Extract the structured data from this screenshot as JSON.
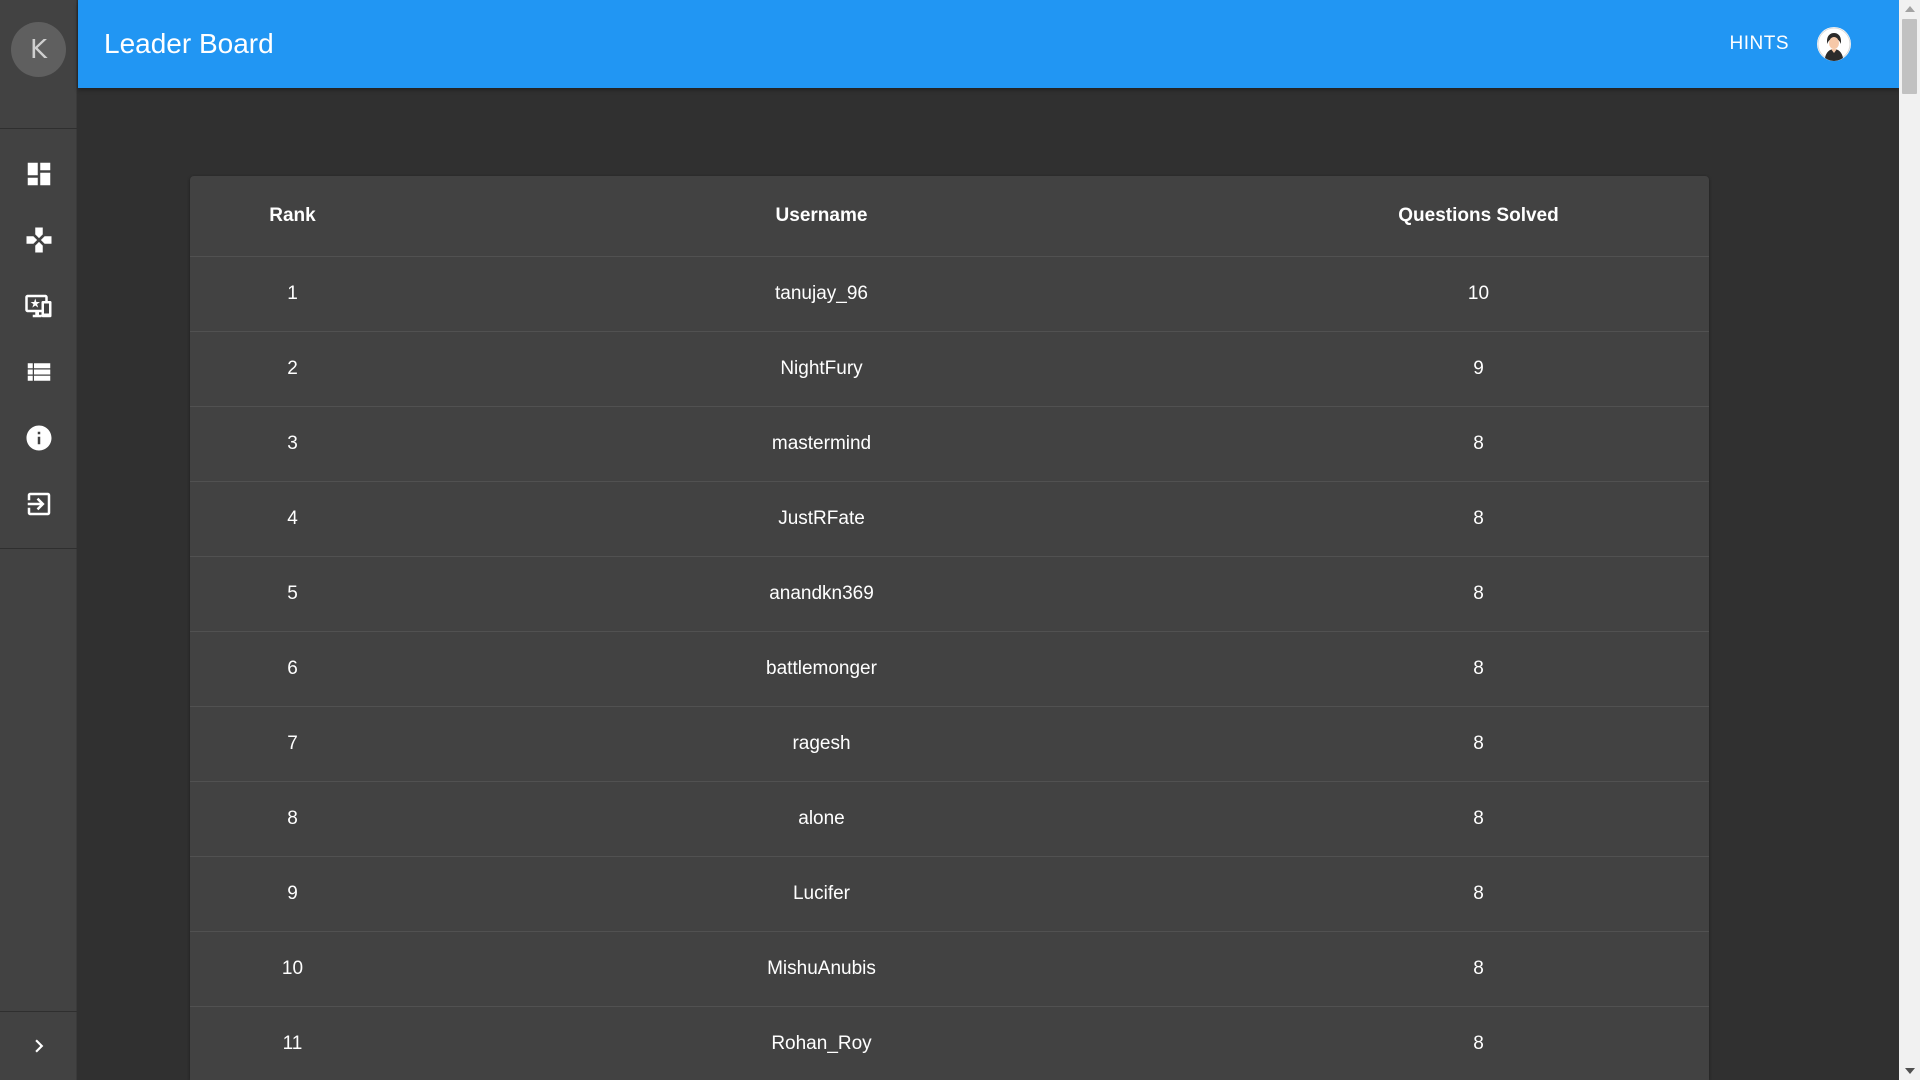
{
  "sidebar": {
    "avatar_letter": "K",
    "items": [
      {
        "icon": "dashboard-icon"
      },
      {
        "icon": "gamepad-icon"
      },
      {
        "icon": "leaderboard-star-monitor-icon"
      },
      {
        "icon": "list-icon"
      },
      {
        "icon": "info-icon"
      },
      {
        "icon": "logout-icon"
      }
    ],
    "expand_icon": "chevron-right-icon"
  },
  "appbar": {
    "title": "Leader Board",
    "hints_label": "HINTS",
    "accent_color": "#2196f3"
  },
  "table": {
    "headers": [
      "Rank",
      "Username",
      "Questions Solved"
    ],
    "rows": [
      {
        "rank": "1",
        "username": "tanujay_96",
        "solved": "10"
      },
      {
        "rank": "2",
        "username": "NightFury",
        "solved": "9"
      },
      {
        "rank": "3",
        "username": "mastermind",
        "solved": "8"
      },
      {
        "rank": "4",
        "username": "JustRFate",
        "solved": "8"
      },
      {
        "rank": "5",
        "username": "anandkn369",
        "solved": "8"
      },
      {
        "rank": "6",
        "username": "battlemonger",
        "solved": "8"
      },
      {
        "rank": "7",
        "username": "ragesh",
        "solved": "8"
      },
      {
        "rank": "8",
        "username": "alone",
        "solved": "8"
      },
      {
        "rank": "9",
        "username": "Lucifer",
        "solved": "8"
      },
      {
        "rank": "10",
        "username": "MishuAnubis",
        "solved": "8"
      },
      {
        "rank": "11",
        "username": "Rohan_Roy",
        "solved": "8"
      }
    ]
  }
}
